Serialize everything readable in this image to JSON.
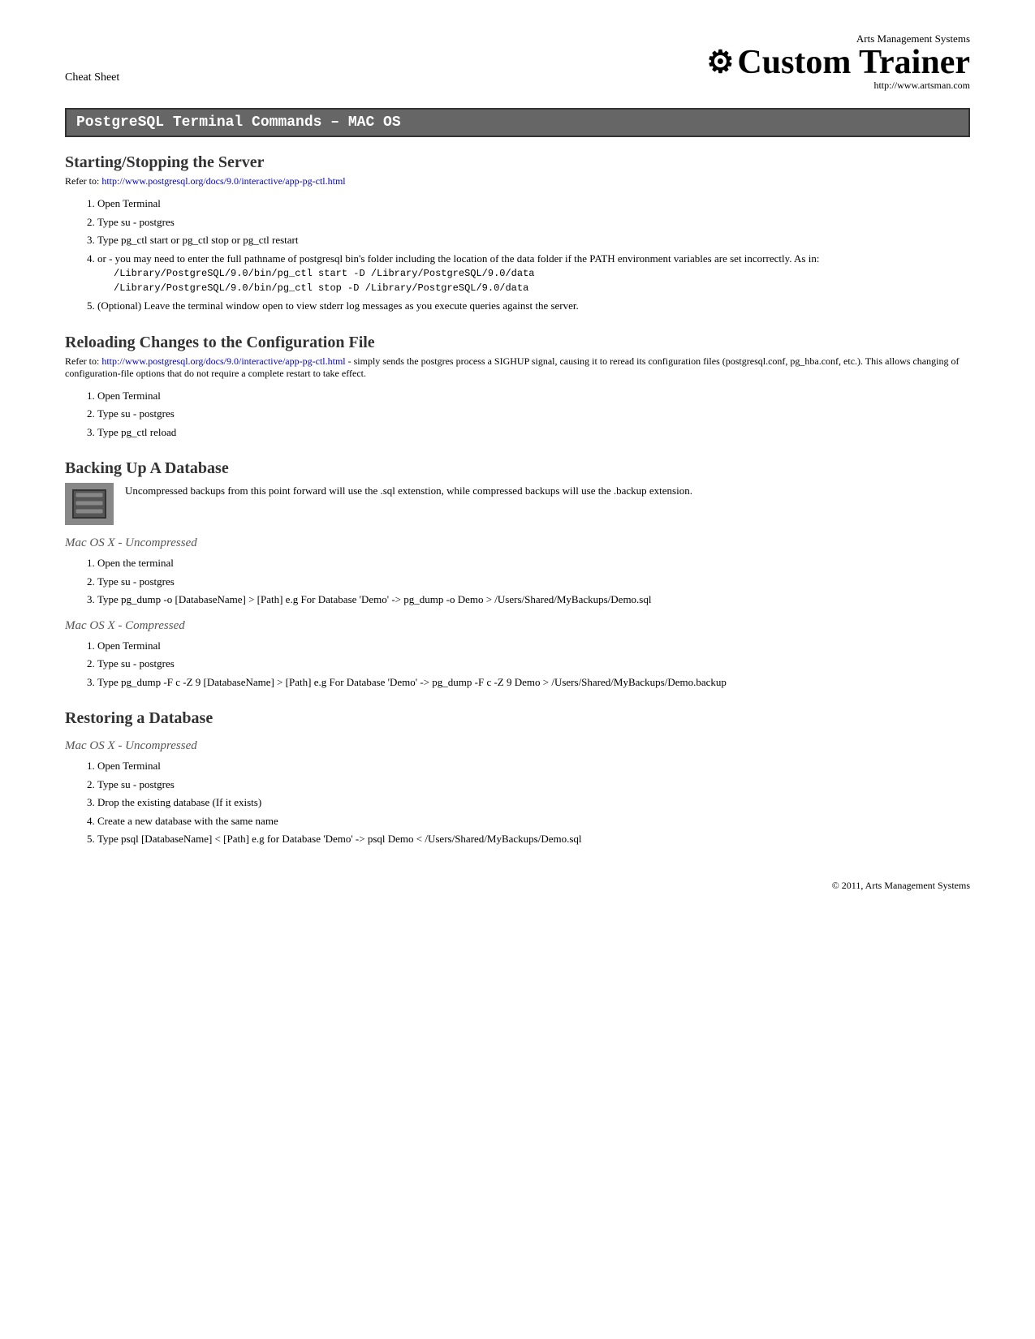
{
  "header": {
    "cheat_sheet_label": "Cheat Sheet",
    "company_name": "Arts Management Systems",
    "app_title": "Custom Trainer",
    "app_title_gear": "⚙",
    "app_url": "http://www.artsman.com"
  },
  "main_title": "PostgreSQL Terminal Commands – MAC OS",
  "sections": {
    "starting_stopping": {
      "title": "Starting/Stopping the Server",
      "ref_prefix": "Refer to: ",
      "ref_url": "http://www.postgresql.org/docs/9.0/interactive/app-pg-ctl.html",
      "steps": [
        "Open Terminal",
        "Type su - postgres",
        "Type pg_ctl start or pg_ctl stop or pg_ctl restart",
        "or - you may need to enter the full pathname of postgresql bin's folder including the location of the data folder if the PATH environment variables are set incorrectly. As in:",
        "(Optional) Leave the terminal window open to view stderr log messages as you execute queries against the server."
      ],
      "code_lines": [
        "/Library/PostgreSQL/9.0/bin/pg_ctl start -D /Library/PostgreSQL/9.0/data",
        "/Library/PostgreSQL/9.0/bin/pg_ctl stop -D /Library/PostgreSQL/9.0/data"
      ]
    },
    "reloading": {
      "title": "Reloading Changes to the Configuration File",
      "ref_prefix": "Refer to: ",
      "ref_url": "http://www.postgresql.org/docs/9.0/interactive/app-pg-ctl.html",
      "ref_suffix": " - simply sends the postgres process a SIGHUP signal, causing it to reread its configuration files (postgresql.conf, pg_hba.conf, etc.). This allows changing of configuration-file options that do not require a complete restart to take effect.",
      "steps": [
        "Open Terminal",
        "Type su - postgres",
        "Type pg_ctl reload"
      ]
    },
    "backup": {
      "title": "Backing Up A Database",
      "note_text": "Uncompressed backups from this point forward will use the .sql extenstion, while compressed backups will use the .backup extension.",
      "subsections": {
        "uncompressed": {
          "title": "Mac OS X - Uncompressed",
          "steps": [
            "Open the terminal",
            "Type su - postgres",
            "Type pg_dump -o [DatabaseName] > [Path] e.g For Database 'Demo' -> pg_dump -o Demo > /Users/Shared/MyBackups/Demo.sql"
          ]
        },
        "compressed": {
          "title": "Mac OS X - Compressed",
          "steps": [
            "Open Terminal",
            "Type su - postgres",
            "Type pg_dump -F c -Z 9 [DatabaseName] > [Path] e.g For Database 'Demo' -> pg_dump -F c -Z 9 Demo > /Users/Shared/MyBackups/Demo.backup"
          ]
        }
      }
    },
    "restoring": {
      "title": "Restoring a Database",
      "subsections": {
        "uncompressed": {
          "title": "Mac OS X - Uncompressed",
          "steps": [
            "Open Terminal",
            "Type su - postgres",
            "Drop the existing database (If it exists)",
            "Create a new database with the same name",
            "Type psql [DatabaseName] < [Path] e.g for Database 'Demo' -> psql Demo < /Users/Shared/MyBackups/Demo.sql"
          ]
        }
      }
    }
  },
  "footer": {
    "text": "© 2011, Arts Management Systems"
  }
}
